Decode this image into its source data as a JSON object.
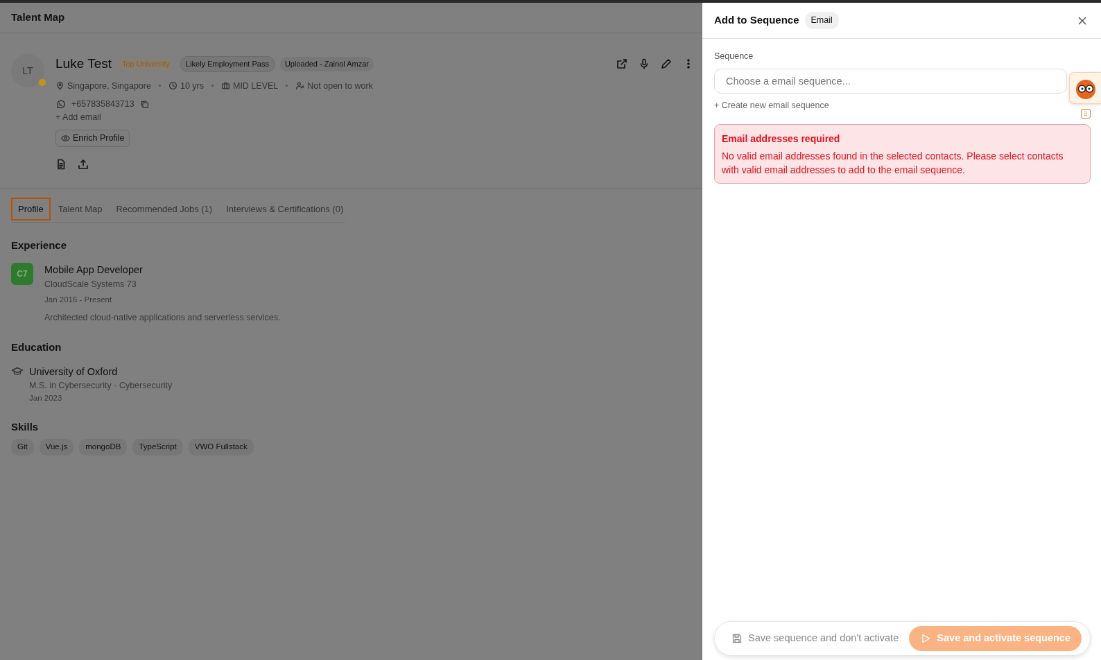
{
  "app": {
    "title": "Talent Map"
  },
  "candidate": {
    "initials": "LT",
    "name": "Luke Test",
    "tags": [
      {
        "label": "Top University",
        "kind": "highlight"
      },
      {
        "label": "Likely Employment Pass",
        "kind": "outline"
      },
      {
        "label": "Uploaded - Zainol Amzar",
        "kind": "plain"
      }
    ],
    "meta": [
      {
        "kind": "location",
        "text": "Singapore, Singapore"
      },
      {
        "kind": "years",
        "text": "10 yrs"
      },
      {
        "kind": "level",
        "text": "MID LEVEL"
      },
      {
        "kind": "availability",
        "text": "Not open to work"
      }
    ],
    "phone": "+657835843713",
    "add_email": "+ Add email",
    "enrich_button": "Enrich Profile"
  },
  "tabs": [
    {
      "label": "Profile",
      "selected": true
    },
    {
      "label": "Talent Map",
      "selected": false
    },
    {
      "label": "Recommended Jobs (1)",
      "selected": false
    },
    {
      "label": "Interviews & Certifications (0)",
      "selected": false
    }
  ],
  "experience": {
    "heading": "Experience",
    "items": [
      {
        "logo": "C7",
        "title": "Mobile App Developer",
        "company": "CloudScale Systems 73",
        "dates": "Jan 2016 - Present",
        "description": "Architected cloud-native applications and serverless services."
      }
    ]
  },
  "education": {
    "heading": "Education",
    "items": [
      {
        "school": "University of Oxford",
        "degree": "M.S. in Cybersecurity · Cybersecurity",
        "date": "Jan 2023"
      }
    ]
  },
  "skills": {
    "heading": "Skills",
    "items": [
      "Git",
      "Vue.js",
      "mongoDB",
      "TypeScript",
      "VWO Fullstack"
    ]
  },
  "panel": {
    "title": "Add to Sequence",
    "badge": "Email",
    "field_label": "Sequence",
    "placeholder": "Choose a email sequence...",
    "create_link": "+ Create new email sequence",
    "alert": {
      "title": "Email addresses required",
      "message": "No valid email addresses found in the selected contacts. Please select contacts with valid email addresses to add to the email sequence."
    },
    "buttons": [
      {
        "label": "Save sequence and don't activate",
        "kind": "secondary",
        "disabled": true
      },
      {
        "label": "Save and activate sequence",
        "kind": "primary",
        "disabled": true
      }
    ]
  }
}
